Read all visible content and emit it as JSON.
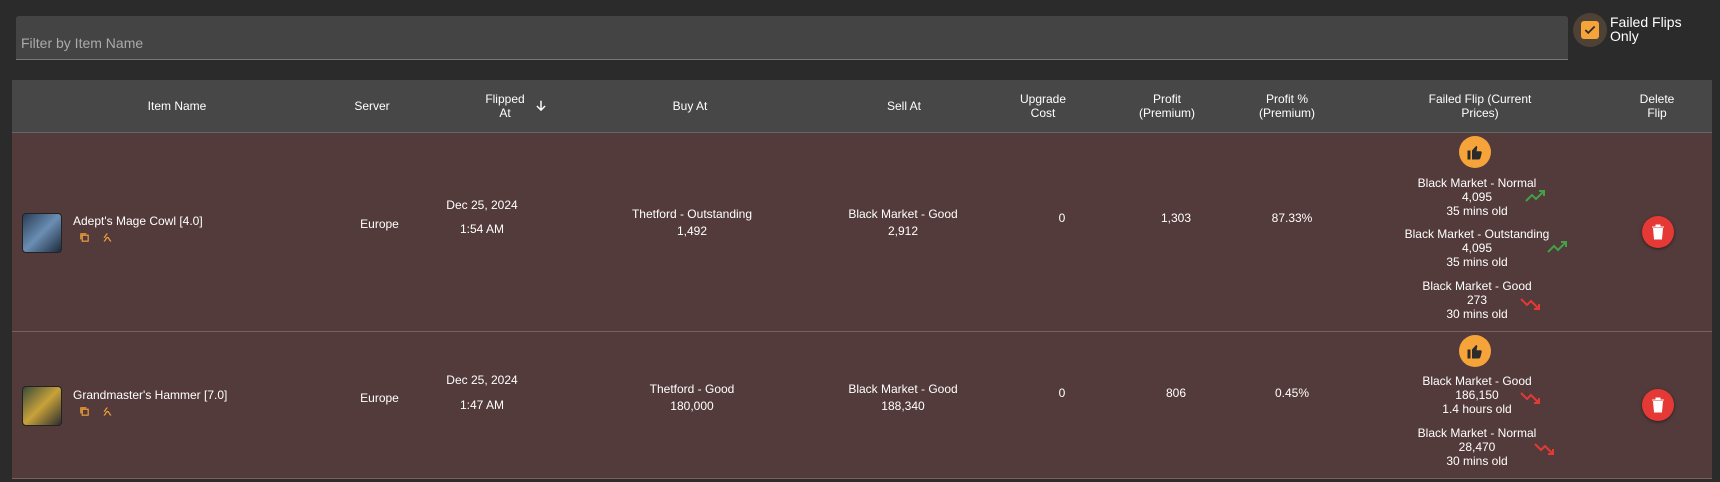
{
  "filter": {
    "placeholder": "Filter by Item Name",
    "value": ""
  },
  "failed_only": {
    "label": "Failed Flips Only",
    "checked": true
  },
  "columns": {
    "item_name": "Item Name",
    "server": "Server",
    "flipped_at": "Flipped At",
    "buy_at": "Buy At",
    "sell_at": "Sell At",
    "upgrade_cost": "Upgrade Cost",
    "profit": "Profit (Premium)",
    "profit_pct": "Profit % (Premium)",
    "failed_flip": "Failed Flip (Current Prices)",
    "delete": "Delete Flip"
  },
  "rows": [
    {
      "item_name": "Adept's Mage Cowl [4.0]",
      "server": "Europe",
      "date": "Dec 25, 2024",
      "time": "1:54 AM",
      "buy_location": "Thetford - Outstanding",
      "buy_price": "1,492",
      "sell_location": "Black Market - Good",
      "sell_price": "2,912",
      "upgrade_cost": "0",
      "profit": "1,303",
      "profit_pct": "87.33%",
      "prices": [
        {
          "market": "Black Market - Normal",
          "price": "4,095",
          "age": "35 mins old",
          "trend": "up"
        },
        {
          "market": "Black Market - Outstanding",
          "price": "4,095",
          "age": "35 mins old",
          "trend": "up"
        },
        {
          "market": "Black Market - Good",
          "price": "273",
          "age": "30 mins old",
          "trend": "down"
        }
      ]
    },
    {
      "item_name": "Grandmaster's Hammer [7.0]",
      "server": "Europe",
      "date": "Dec 25, 2024",
      "time": "1:47 AM",
      "buy_location": "Thetford - Good",
      "buy_price": "180,000",
      "sell_location": "Black Market - Good",
      "sell_price": "188,340",
      "upgrade_cost": "0",
      "profit": "806",
      "profit_pct": "0.45%",
      "prices": [
        {
          "market": "Black Market - Good",
          "price": "186,150",
          "age": "1.4 hours old",
          "trend": "down"
        },
        {
          "market": "Black Market - Normal",
          "price": "28,470",
          "age": "30 mins old",
          "trend": "down"
        }
      ]
    }
  ],
  "colors": {
    "accent": "#f6a43a",
    "row_bg": "#533b3b",
    "trend_up": "#43a047",
    "trend_down": "#e53935",
    "delete": "#e53935"
  },
  "icons": {
    "sort": "arrow-down-icon",
    "copy": "copy-icon",
    "link": "link-icon",
    "thumbs_up": "thumbs-up-icon",
    "trend_up": "trending-up-icon",
    "trend_down": "trending-down-icon",
    "delete": "trash-icon",
    "check": "check-icon"
  }
}
